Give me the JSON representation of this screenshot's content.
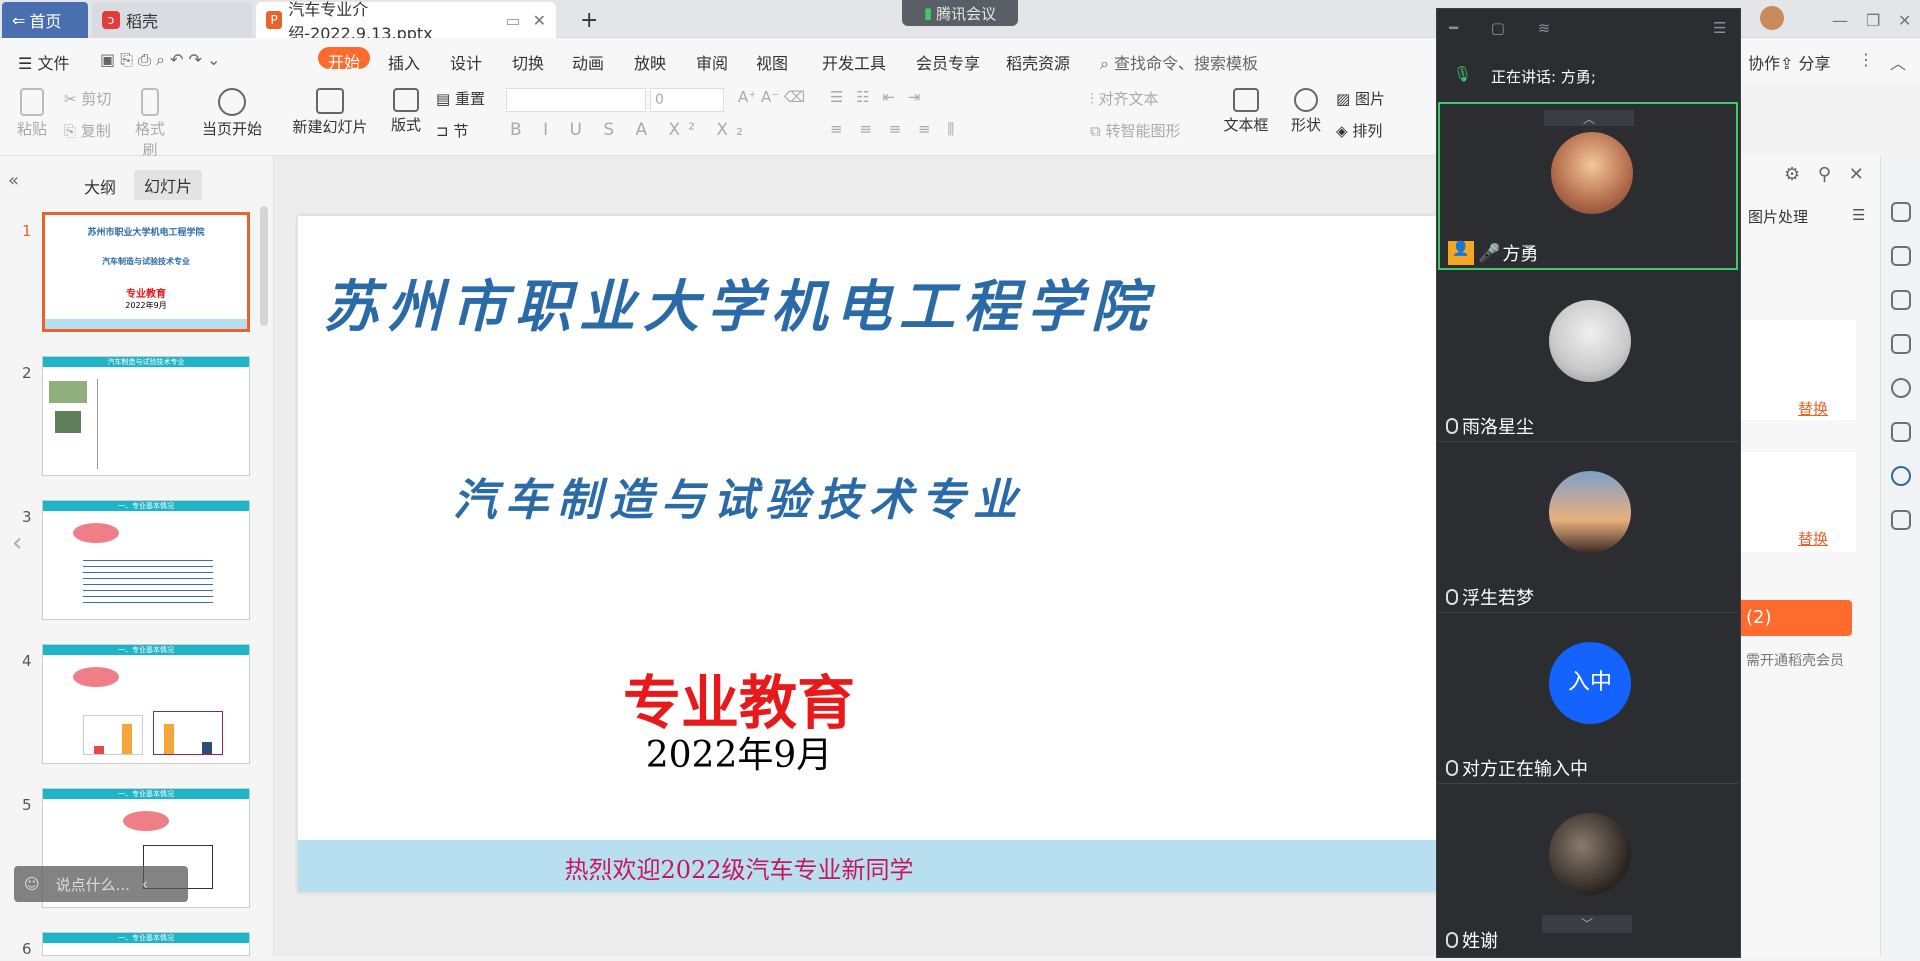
{
  "tabs": {
    "home": "首页",
    "daoke": "稻壳",
    "file": "汽车专业介绍-2022.9.13.pptx",
    "new_tab": "+"
  },
  "meeting_chip": "腾讯会议",
  "menu": {
    "file": "文件",
    "items": [
      "开始",
      "插入",
      "设计",
      "切换",
      "动画",
      "放映",
      "审阅",
      "视图",
      "开发工具",
      "会员专享",
      "稻壳资源"
    ],
    "search": "查找命令、搜索模板",
    "collab": "协作",
    "share": "分享"
  },
  "ribbon": {
    "paste": "粘贴",
    "cut": "剪切",
    "copy": "复制",
    "format_painter": "格式刷",
    "start_from_current": "当页开始",
    "new_slide": "新建幻灯片",
    "layout": "版式",
    "section": "节",
    "reset": "重置",
    "font_size": "0",
    "align_text": "对齐文本",
    "smart_shape": "转智能图形",
    "textbox": "文本框",
    "shape": "形状",
    "arrange": "排列",
    "picture": "图片"
  },
  "panel_tabs": {
    "outline": "大纲",
    "slides": "幻灯片"
  },
  "thumbs": [
    {
      "num": "1",
      "line1": "苏州市职业大学机电工程学院",
      "line2": "汽车制造与试验技术专业",
      "line3": "专业教育",
      "line4": "2022年9月"
    },
    {
      "num": "2",
      "title": "汽车制造与试验技术专业"
    },
    {
      "num": "3",
      "title": "一、专业基本情况"
    },
    {
      "num": "4",
      "title": "一、专业基本情况"
    },
    {
      "num": "5",
      "title": "一、专业基本情况"
    },
    {
      "num": "6",
      "title": "一、专业基本情况"
    }
  ],
  "comment_placeholder": "说点什么...",
  "slide": {
    "title": "苏州市职业大学机电工程学院",
    "subtitle": "汽车制造与试验技术专业",
    "heading": "专业教育",
    "date": "2022年9月",
    "banner": "热烈欢迎2022级汽车专业新同学"
  },
  "meeting": {
    "speaking": "正在讲话: 方勇;",
    "participants": [
      {
        "name": "方勇"
      },
      {
        "name": "雨洛星尘"
      },
      {
        "name": "浮生若梦"
      },
      {
        "name": "对方正在输入中",
        "initials": "入中"
      },
      {
        "name": "姓谢"
      }
    ]
  },
  "right_pane": {
    "image_process": "图片处理",
    "replace1": "替换",
    "replace2": "替换",
    "count_button": "(2)",
    "vip_hint": "需开通稻壳会员"
  },
  "colors": {
    "accent": "#ff6a2d",
    "title_blue": "#2a6aa6",
    "heading_red": "#e8191b",
    "banner_bg": "#b8dff0",
    "banner_text": "#c7175c",
    "meeting_bg": "#2b2d31",
    "avatar_blue": "#1463ff"
  }
}
